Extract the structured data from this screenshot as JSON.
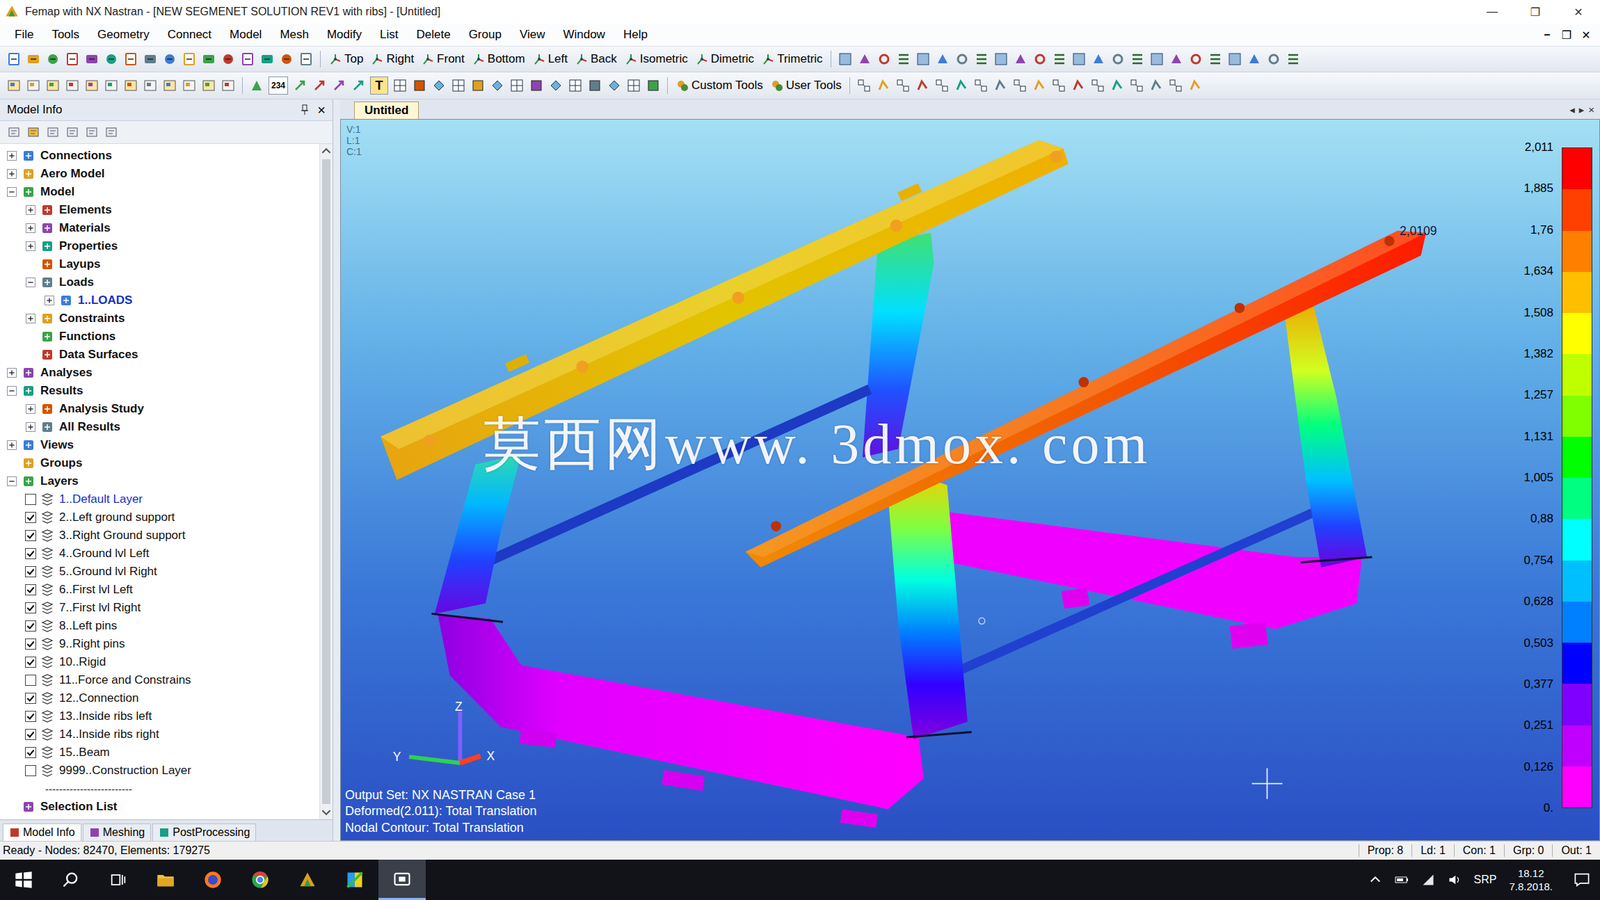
{
  "window": {
    "title": "Femap with NX Nastran - [NEW SEGMENET SOLUTION REV1 with ribs] - [Untitled]",
    "controls": [
      "—",
      "❐",
      "✕"
    ]
  },
  "menu": {
    "items": [
      "File",
      "Tools",
      "Geometry",
      "Connect",
      "Model",
      "Mesh",
      "Modify",
      "List",
      "Delete",
      "Group",
      "View",
      "Window",
      "Help"
    ],
    "doc_controls": [
      "–",
      "❐",
      "✕"
    ]
  },
  "toolbar1": {
    "views": [
      "Top",
      "Right",
      "Front",
      "Bottom",
      "Left",
      "Back",
      "Isometric",
      "Dimetric",
      "Trimetric"
    ]
  },
  "toolbar2": {
    "glyphs": [
      "234",
      "T"
    ],
    "tools": [
      "Custom Tools",
      "User Tools"
    ]
  },
  "model_info": {
    "title": "Model Info",
    "close": "×"
  },
  "tree": [
    {
      "label": "Connections",
      "kind": "node",
      "expandable": true,
      "expanded": false
    },
    {
      "label": "Aero Model",
      "kind": "node",
      "expandable": true,
      "expanded": false
    },
    {
      "label": "Model",
      "kind": "node",
      "expandable": true,
      "expanded": true,
      "children": [
        {
          "label": "Elements",
          "kind": "node",
          "expandable": true,
          "expanded": false
        },
        {
          "label": "Materials",
          "kind": "node",
          "expandable": true,
          "expanded": false
        },
        {
          "label": "Properties",
          "kind": "node",
          "expandable": true,
          "expanded": false
        },
        {
          "label": "Layups",
          "kind": "node",
          "expandable": false,
          "expanded": false
        },
        {
          "label": "Loads",
          "kind": "node",
          "expandable": true,
          "expanded": true,
          "children": [
            {
              "label": "1..LOADS",
              "kind": "node",
              "expandable": true,
              "expanded": false,
              "active": true
            }
          ]
        },
        {
          "label": "Constraints",
          "kind": "node",
          "expandable": true,
          "expanded": false
        },
        {
          "label": "Functions",
          "kind": "node",
          "expandable": false,
          "expanded": false
        },
        {
          "label": "Data Surfaces",
          "kind": "node",
          "expandable": false,
          "expanded": false
        }
      ]
    },
    {
      "label": "Analyses",
      "kind": "node",
      "expandable": true,
      "expanded": false
    },
    {
      "label": "Results",
      "kind": "node",
      "expandable": true,
      "expanded": true,
      "children": [
        {
          "label": "Analysis Study",
          "kind": "node",
          "expandable": true,
          "expanded": false
        },
        {
          "label": "All Results",
          "kind": "node",
          "expandable": true,
          "expanded": false
        }
      ]
    },
    {
      "label": "Views",
      "kind": "node",
      "expandable": true,
      "expanded": false
    },
    {
      "label": "Groups",
      "kind": "node",
      "expandable": false,
      "expanded": false
    },
    {
      "label": "Layers",
      "kind": "node",
      "expandable": true,
      "expanded": true,
      "children": [
        {
          "label": "1..Default Layer",
          "kind": "layer",
          "checked": false,
          "active": true
        },
        {
          "label": "2..Left ground support",
          "kind": "layer",
          "checked": true,
          "active": false
        },
        {
          "label": "3..Right Ground support",
          "kind": "layer",
          "checked": true,
          "active": false
        },
        {
          "label": "4..Ground lvl Left",
          "kind": "layer",
          "checked": true,
          "active": false
        },
        {
          "label": "5..Ground lvl Right",
          "kind": "layer",
          "checked": true,
          "active": false
        },
        {
          "label": "6..First lvl Left",
          "kind": "layer",
          "checked": true,
          "active": false
        },
        {
          "label": "7..First lvl Right",
          "kind": "layer",
          "checked": true,
          "active": false
        },
        {
          "label": "8..Left pins",
          "kind": "layer",
          "checked": true,
          "active": false
        },
        {
          "label": "9..Right pins",
          "kind": "layer",
          "checked": true,
          "active": false
        },
        {
          "label": "10..Rigid",
          "kind": "layer",
          "checked": true,
          "active": false
        },
        {
          "label": "11..Force and Constrains",
          "kind": "layer",
          "checked": false,
          "active": false
        },
        {
          "label": "12..Connection",
          "kind": "layer",
          "checked": true,
          "active": false
        },
        {
          "label": "13..Inside ribs left",
          "kind": "layer",
          "checked": true,
          "active": false
        },
        {
          "label": "14..Inside ribs right",
          "kind": "layer",
          "checked": true,
          "active": false
        },
        {
          "label": "15..Beam",
          "kind": "layer",
          "checked": true,
          "active": false
        },
        {
          "label": "9999..Construction Layer",
          "kind": "layer",
          "checked": false,
          "active": false
        },
        {
          "label": "-------------------------",
          "kind": "separator"
        }
      ]
    },
    {
      "label": "Selection List",
      "kind": "node",
      "expandable": false,
      "expanded": false
    }
  ],
  "bottom_tabs": [
    {
      "label": "Model Info",
      "selected": true
    },
    {
      "label": "Meshing",
      "selected": false
    },
    {
      "label": "PostProcessing",
      "selected": false
    }
  ],
  "doc_tabs": [
    {
      "label": "Untitled",
      "selected": true
    }
  ],
  "doc_nav": [
    "◂",
    "▸",
    "×"
  ],
  "viewport": {
    "corner": [
      "V:1",
      "L:1",
      "C:1"
    ],
    "watermark": "莫西网www. 3dmox. com",
    "peak_label": "2,0109",
    "axes": [
      "X",
      "Y",
      "Z"
    ],
    "info": [
      "Output Set: NX NASTRAN Case 1",
      "Deformed(2.011): Total Translation",
      "Nodal Contour: Total Translation"
    ]
  },
  "legend": {
    "labels": [
      "2,011",
      "1,885",
      "1,76",
      "1,634",
      "1,508",
      "1,382",
      "1,257",
      "1,131",
      "1,005",
      "0,88",
      "0,754",
      "0,628",
      "0,503",
      "0,377",
      "0,251",
      "0,126",
      "0."
    ],
    "bands": [
      "#ff0000",
      "#ff4000",
      "#ff8000",
      "#ffbf00",
      "#ffff00",
      "#bfff00",
      "#80ff00",
      "#00ff00",
      "#00ff80",
      "#00ffff",
      "#00bfff",
      "#0080ff",
      "#0000ff",
      "#8000ff",
      "#bf00ff",
      "#ff00ff"
    ]
  },
  "status_bar": {
    "text": "Ready - Nodes: 82470, Elements: 179275",
    "cells": [
      "Prop: 8",
      "Ld: 1",
      "Con: 1",
      "Grp: 0",
      "Out: 1"
    ]
  },
  "taskbar": {
    "language": "SRP",
    "time": "18.12",
    "date": "7.8.2018."
  }
}
